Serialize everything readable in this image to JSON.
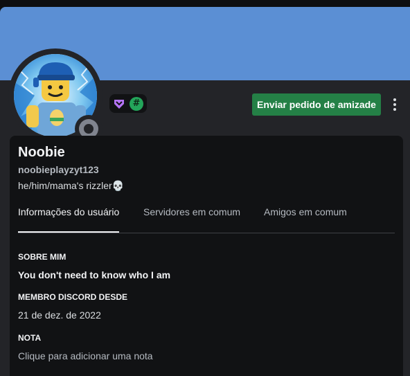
{
  "profile": {
    "display_name": "Noobie",
    "username": "noobieplayzyt123",
    "pronouns": "he/him/mama's rizzler",
    "pronouns_emoji": "💀",
    "status": "offline",
    "avatar_icon": "roblox-noob-avatar",
    "badges": [
      {
        "name": "nitro-badge-icon",
        "color": "#b473f5"
      },
      {
        "name": "hashtag-badge-icon",
        "glyph": "#",
        "color": "#23a55a"
      }
    ]
  },
  "colors": {
    "banner": "#5b8fd4",
    "accent_button": "#248046",
    "background": "#232428",
    "panel": "#111214"
  },
  "actions": {
    "friend_request_label": "Enviar pedido de amizade"
  },
  "tabs": [
    {
      "label": "Informações do usuário",
      "active": true
    },
    {
      "label": "Servidores em comum",
      "active": false
    },
    {
      "label": "Amigos em comum",
      "active": false
    }
  ],
  "info": {
    "about_heading": "SOBRE MIM",
    "about_text": "You don't need to know who I am",
    "member_since_heading": "MEMBRO DISCORD DESDE",
    "member_since_value": "21 de dez. de 2022",
    "note_heading": "NOTA",
    "note_placeholder": "Clique para adicionar uma nota"
  }
}
